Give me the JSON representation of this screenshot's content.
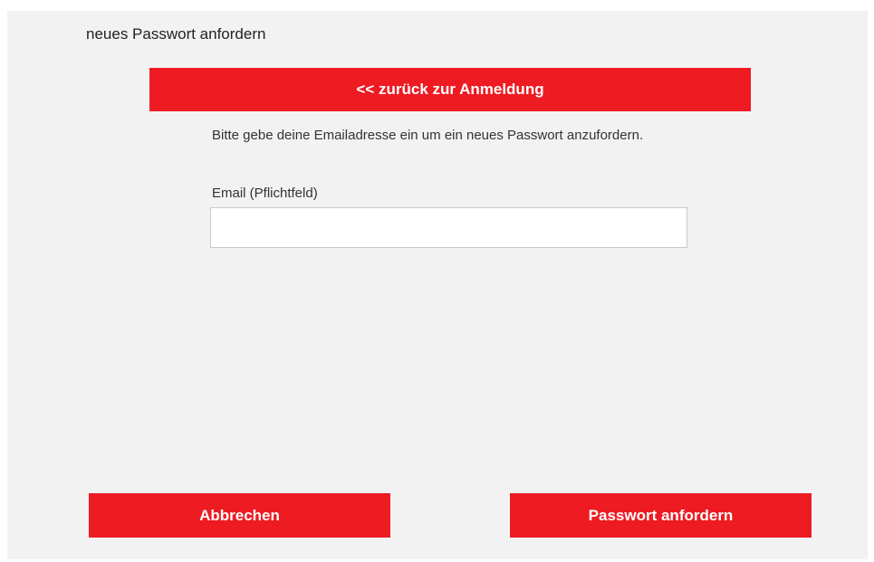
{
  "dialog": {
    "title": "neues Passwort anfordern",
    "back_label": "<< zurück zur Anmeldung",
    "instruction": "Bitte gebe deine Emailadresse ein um ein neues Passwort anzufordern.",
    "email": {
      "label": "Email (Pflichtfeld)",
      "value": "",
      "placeholder": ""
    },
    "cancel_label": "Abbrechen",
    "submit_label": "Passwort anfordern"
  },
  "colors": {
    "accent": "#ee1b23",
    "panel_background": "#f2f2f3",
    "text": "#333333",
    "button_text": "#ffffff"
  }
}
